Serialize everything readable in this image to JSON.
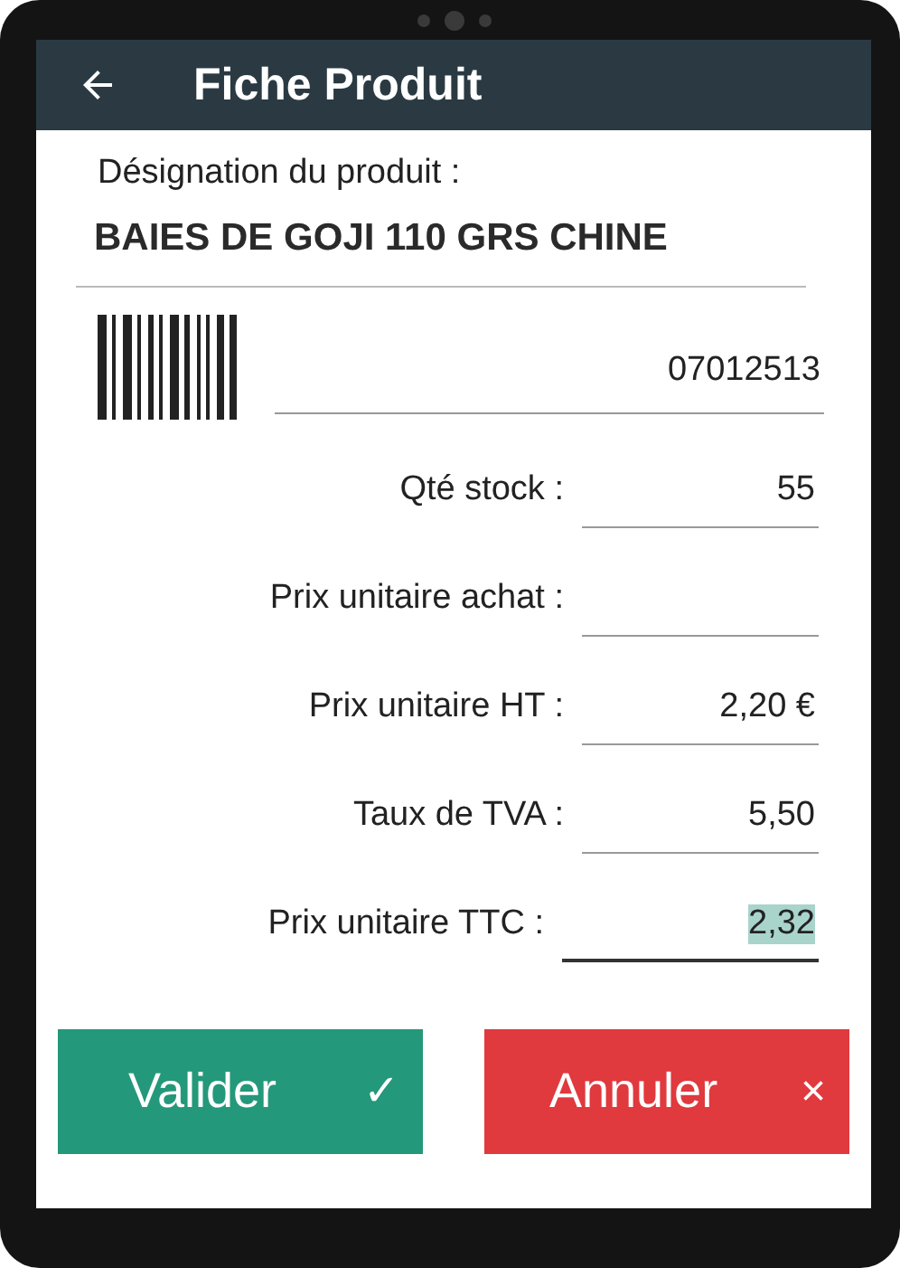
{
  "header": {
    "title": "Fiche Produit"
  },
  "product": {
    "label": "Désignation du produit :",
    "name": "BAIES DE GOJI 110 GRS CHINE"
  },
  "barcode": {
    "value": "07012513"
  },
  "fields": [
    {
      "label": "Qté stock :",
      "value": "55",
      "focused": false
    },
    {
      "label": "Prix unitaire achat :",
      "focused": false
    },
    {
      "label": "Prix unitaire HT :",
      "value": "2,20 €",
      "focused": false
    },
    {
      "label": "Taux de TVA :",
      "value": "5,50",
      "focused": false
    },
    {
      "label": "Prix unitaire TTC :",
      "value": "2,32",
      "focused": true
    }
  ],
  "buttons": [
    {
      "kind": "validate",
      "label": "Valider",
      "icon": "✓"
    },
    {
      "kind": "cancel",
      "label": "Annuler",
      "icon": "×"
    }
  ]
}
